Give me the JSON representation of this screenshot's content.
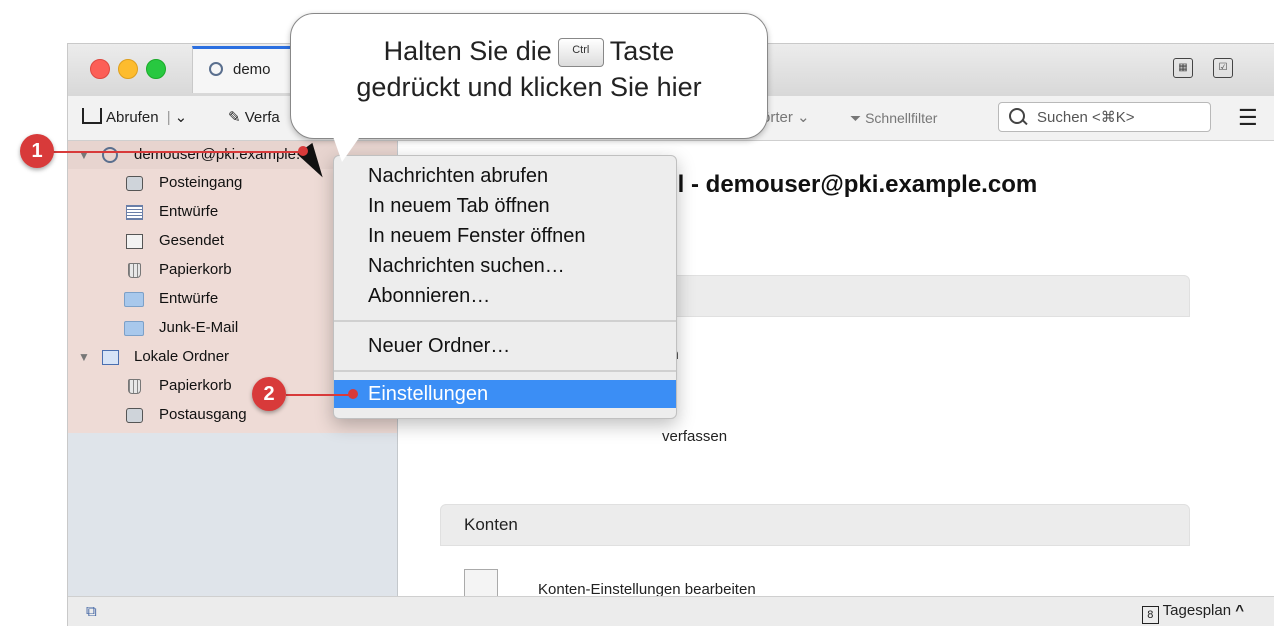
{
  "tab": {
    "title": "demo"
  },
  "toolbar": {
    "fetch_label": "Abrufen",
    "compose_label": "Verfa",
    "words_label": "örter",
    "quickfilter_label": "Schnellfilter",
    "search_placeholder": "Suchen <⌘K>"
  },
  "sidebar": {
    "account": "demouser@pki.example.c",
    "folders": [
      "Posteingang",
      "Entwürfe",
      "Gesendet",
      "Papierkorb",
      "Entwürfe",
      "Junk-E-Mail"
    ],
    "local_label": "Lokale Ordner",
    "local_folders": [
      "Papierkorb",
      "Postausgang"
    ]
  },
  "main": {
    "title": "il - demouser@pki.example.com",
    "text1": "en",
    "text2": "verfassen",
    "section_accounts": "Konten",
    "accounts_link": "Konten-Einstellungen bearbeiten"
  },
  "context_menu": {
    "items": [
      "Nachrichten abrufen",
      "In neuem Tab öffnen",
      "In neuem Fenster öffnen",
      "Nachrichten suchen…",
      "Abonnieren…",
      "Neuer Ordner…",
      "Einstellungen"
    ]
  },
  "callout": {
    "line1_a": "Halten Sie die",
    "key": "Ctrl",
    "line1_b": "Taste",
    "line2": "gedrückt und klicken Sie hier"
  },
  "markers": [
    "1",
    "2"
  ],
  "status": {
    "right_label": "Tagesplan",
    "calendar_day": "8"
  },
  "colors": {
    "accent": "#3b8ef5",
    "marker": "#d83a3a",
    "selected_row": "#e7d4cf"
  }
}
